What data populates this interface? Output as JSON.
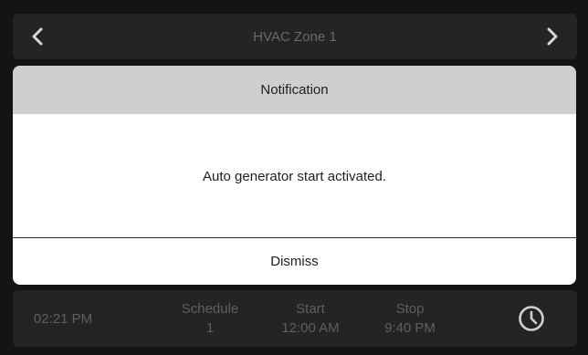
{
  "header": {
    "title": "HVAC Zone 1",
    "prev_icon": "chevron-left-icon",
    "next_icon": "chevron-right-icon"
  },
  "dialog": {
    "title": "Notification",
    "message": "Auto generator start activated.",
    "dismiss_label": "Dismiss"
  },
  "footer": {
    "time": "02:21 PM",
    "schedule_label": "Schedule",
    "schedule_value": "1",
    "start_label": "Start",
    "start_value": "12:00 AM",
    "stop_label": "Stop",
    "stop_value": "9:40 PM",
    "clock_icon": "clock-icon"
  },
  "colors": {
    "background": "#141414",
    "panel": "#242424",
    "dialog_header": "#cfcfcf",
    "dialog_body": "#ffffff"
  }
}
